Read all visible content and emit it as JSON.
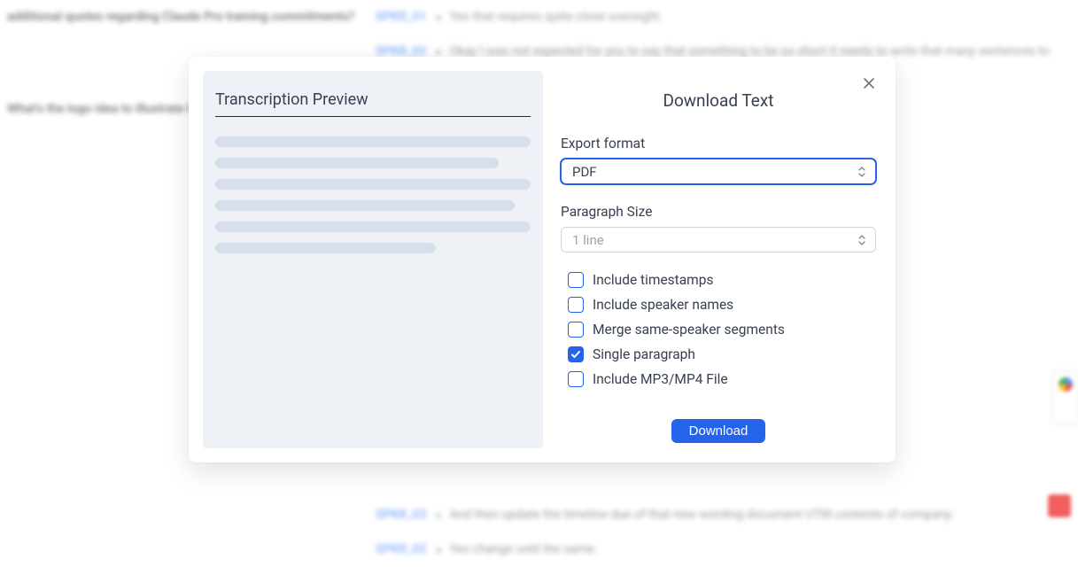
{
  "modal": {
    "preview_title": "Transcription Preview",
    "title": "Download Text",
    "export_format_label": "Export format",
    "export_format_value": "PDF",
    "paragraph_size_label": "Paragraph Size",
    "paragraph_size_value": "1 line",
    "options": [
      {
        "label": "Include timestamps",
        "checked": false
      },
      {
        "label": "Include speaker names",
        "checked": false
      },
      {
        "label": "Merge same-speaker segments",
        "checked": false
      },
      {
        "label": "Single paragraph",
        "checked": true
      },
      {
        "label": "Include MP3/MP4 File",
        "checked": false
      }
    ],
    "download_button": "Download"
  }
}
